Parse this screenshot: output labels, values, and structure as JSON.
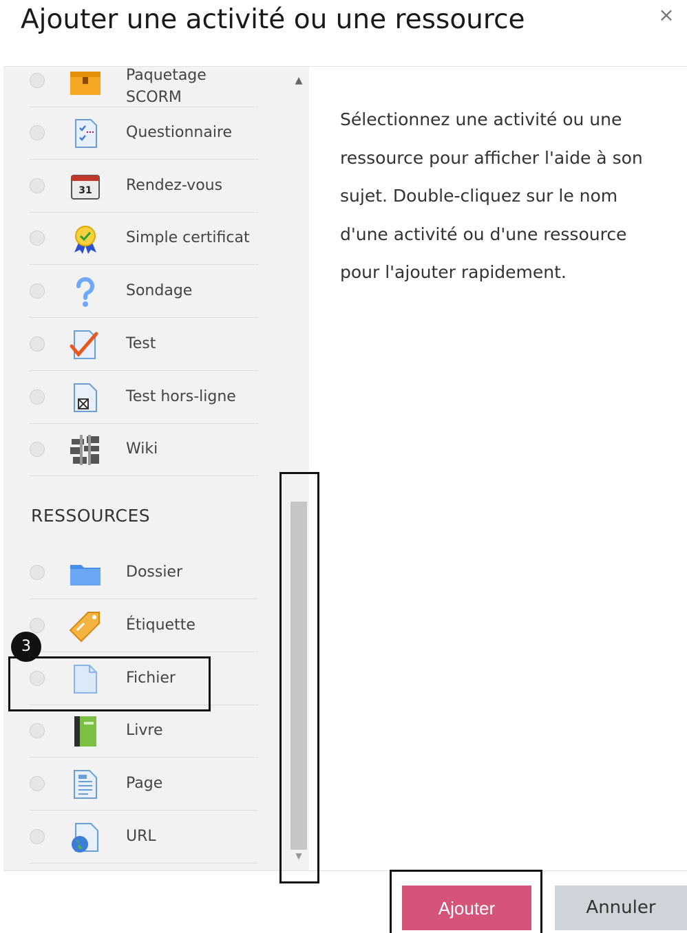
{
  "dialog": {
    "title": "Ajouter une activité ou une ressource",
    "close_symbol": "×"
  },
  "activities": [
    {
      "label": "Paquetage SCORM",
      "icon": "scorm-package-icon"
    },
    {
      "label": "Questionnaire",
      "icon": "questionnaire-icon"
    },
    {
      "label": "Rendez-vous",
      "icon": "calendar-icon"
    },
    {
      "label": "Simple certificat",
      "icon": "certificate-icon"
    },
    {
      "label": "Sondage",
      "icon": "question-mark-icon"
    },
    {
      "label": "Test",
      "icon": "quiz-checkmark-icon"
    },
    {
      "label": "Test hors-ligne",
      "icon": "offline-quiz-icon"
    },
    {
      "label": "Wiki",
      "icon": "wiki-icon"
    }
  ],
  "resources_section": {
    "title": "RESSOURCES",
    "items": [
      {
        "label": "Dossier",
        "icon": "folder-icon"
      },
      {
        "label": "Étiquette",
        "icon": "label-tag-icon"
      },
      {
        "label": "Fichier",
        "icon": "file-icon"
      },
      {
        "label": "Livre",
        "icon": "book-icon"
      },
      {
        "label": "Page",
        "icon": "page-icon"
      },
      {
        "label": "URL",
        "icon": "url-globe-icon"
      }
    ]
  },
  "help_text": "Sélectionnez une activité ou une ressource pour afficher l'aide à son sujet. Double-cliquez sur le nom d'une activité ou d'une ressource pour l'ajouter rapidement.",
  "footer": {
    "add_label": "Ajouter",
    "cancel_label": "Annuler"
  },
  "annotations": {
    "step_badge": "3"
  },
  "colors": {
    "primary_button": "#d4547a",
    "secondary_button": "#ced4da",
    "list_background": "#f2f2f2"
  }
}
